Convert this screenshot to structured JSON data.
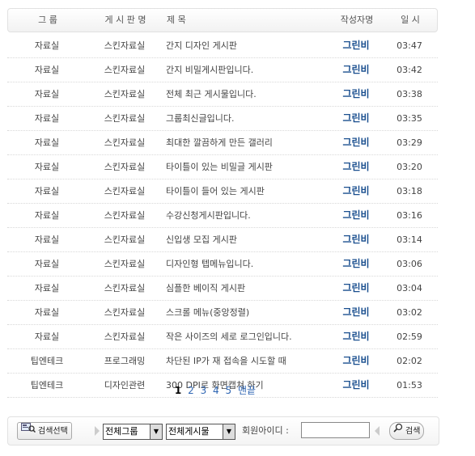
{
  "header": {
    "group": "그   룹",
    "board": "게 시 판 명",
    "title": "제     목",
    "author": "작성자명",
    "time": "일   시"
  },
  "rows": [
    {
      "group": "자료실",
      "board": "스킨자료실",
      "title": "간지 디자인 게시판",
      "author": "그린비",
      "time": "03:47"
    },
    {
      "group": "자료실",
      "board": "스킨자료실",
      "title": "간지 비밀게시판입니다.",
      "author": "그린비",
      "time": "03:42"
    },
    {
      "group": "자료실",
      "board": "스킨자료실",
      "title": "전체 최근 게시물입니다.",
      "author": "그린비",
      "time": "03:38"
    },
    {
      "group": "자료실",
      "board": "스킨자료실",
      "title": "그룹최신글입니다.",
      "author": "그린비",
      "time": "03:35"
    },
    {
      "group": "자료실",
      "board": "스킨자료실",
      "title": "최대한 깔끔하게 만든 갤러리",
      "author": "그린비",
      "time": "03:29"
    },
    {
      "group": "자료실",
      "board": "스킨자료실",
      "title": "타이틀이 있는 비밀글 게시판",
      "author": "그린비",
      "time": "03:20"
    },
    {
      "group": "자료실",
      "board": "스킨자료실",
      "title": "타이틀이 들어 있는 게시판",
      "author": "그린비",
      "time": "03:18"
    },
    {
      "group": "자료실",
      "board": "스킨자료실",
      "title": "수강신청게시판입니다.",
      "author": "그린비",
      "time": "03:16"
    },
    {
      "group": "자료실",
      "board": "스킨자료실",
      "title": "신입생 모집 게시판",
      "author": "그린비",
      "time": "03:14"
    },
    {
      "group": "자료실",
      "board": "스킨자료실",
      "title": "디자인형 텝메뉴입니다.",
      "author": "그린비",
      "time": "03:06"
    },
    {
      "group": "자료실",
      "board": "스킨자료실",
      "title": "심플한 베이직 게시판",
      "author": "그린비",
      "time": "03:04"
    },
    {
      "group": "자료실",
      "board": "스킨자료실",
      "title": "스크롤 메뉴(중앙정렬)",
      "author": "그린비",
      "time": "03:02"
    },
    {
      "group": "자료실",
      "board": "스킨자료실",
      "title": "작은 사이즈의 세로 로그인입니다.",
      "author": "그린비",
      "time": "02:59"
    },
    {
      "group": "팁엔테크",
      "board": "프로그래밍",
      "title": "차단된 IP가 재 접속을 시도할 때",
      "author": "그린비",
      "time": "02:02"
    },
    {
      "group": "팁엔테크",
      "board": "디자인관련",
      "title": "300 DPI로 화면캡쳐 하기",
      "author": "그린비",
      "time": "01:53"
    }
  ],
  "pager": {
    "pages": [
      "1",
      "2",
      "3",
      "4",
      "5"
    ],
    "current": "1",
    "end_label": "맨끝"
  },
  "search": {
    "search_select_label": "검색선택",
    "group_select": "전체그룹",
    "board_select": "전체게시물",
    "member_id_label": "회원아이디 :",
    "member_id_value": "",
    "search_button": "검색"
  },
  "colors": {
    "author": "#1a4f8f",
    "link": "#2f66b3"
  }
}
